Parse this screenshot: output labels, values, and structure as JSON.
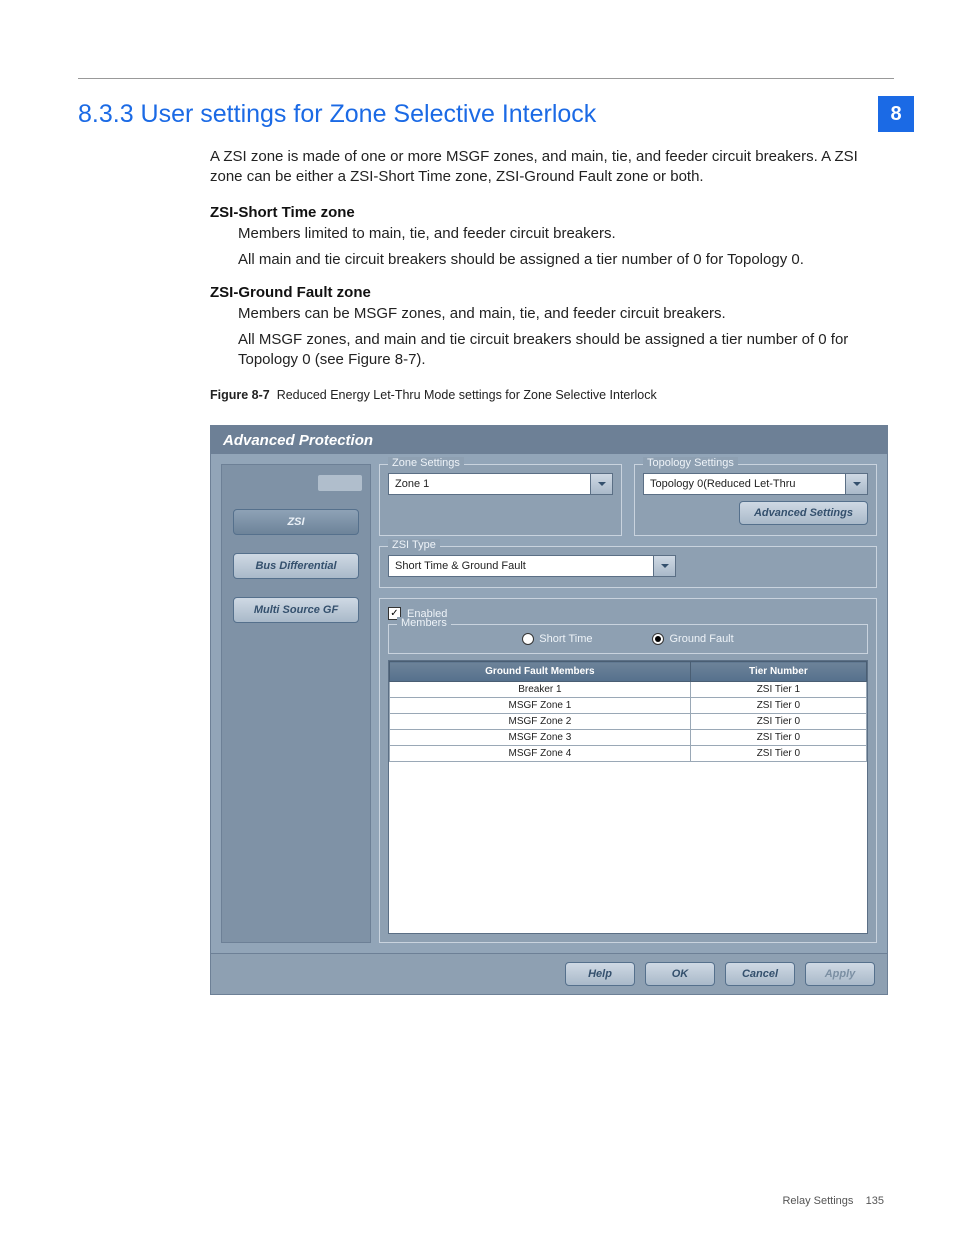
{
  "chapter_num": "8",
  "heading": "8.3.3 User settings for Zone Selective Interlock",
  "intro": "A ZSI zone is made of one or more MSGF zones, and main, tie, and feeder circuit breakers. A ZSI zone can be either a ZSI-Short Time zone, ZSI-Ground Fault zone or both.",
  "st_head": "ZSI-Short Time zone",
  "st_p1": "Members limited to main, tie, and feeder circuit breakers.",
  "st_p2": "All main and tie circuit breakers should be assigned a tier number of 0 for Topology 0.",
  "gf_head": "ZSI-Ground Fault zone",
  "gf_p1": "Members can be MSGF zones, and main, tie, and feeder circuit breakers.",
  "gf_p2": "All MSGF zones, and main and tie circuit breakers should be assigned a tier number of 0 for Topology 0 (see Figure 8-7).",
  "fig_label": "Figure 8-7",
  "fig_caption": "Reduced Energy Let-Thru Mode settings for Zone Selective Interlock",
  "app": {
    "title": "Advanced Protection",
    "sidebar": {
      "zsi": "ZSI",
      "busdiff": "Bus Differential",
      "msgf": "Multi Source GF"
    },
    "zone_settings_label": "Zone Settings",
    "zone_value": "Zone 1",
    "topology_settings_label": "Topology Settings",
    "topology_value": "Topology 0(Reduced Let-Thru",
    "zsi_type_label": "ZSI Type",
    "zsi_type_value": "Short Time & Ground Fault",
    "adv_settings": "Advanced Settings",
    "enabled_label": "Enabled",
    "members_label": "Members",
    "radio_short": "Short Time",
    "radio_gf": "Ground Fault",
    "col_members": "Ground Fault Members",
    "col_tier": "Tier Number",
    "rows": [
      {
        "m": "Breaker 1",
        "t": "ZSI Tier 1"
      },
      {
        "m": "MSGF Zone 1",
        "t": "ZSI Tier 0"
      },
      {
        "m": "MSGF Zone 2",
        "t": "ZSI Tier 0"
      },
      {
        "m": "MSGF Zone 3",
        "t": "ZSI Tier 0"
      },
      {
        "m": "MSGF Zone 4",
        "t": "ZSI Tier 0"
      }
    ],
    "buttons": {
      "help": "Help",
      "ok": "OK",
      "cancel": "Cancel",
      "apply": "Apply"
    }
  },
  "footer_section": "Relay Settings",
  "footer_page": "135"
}
